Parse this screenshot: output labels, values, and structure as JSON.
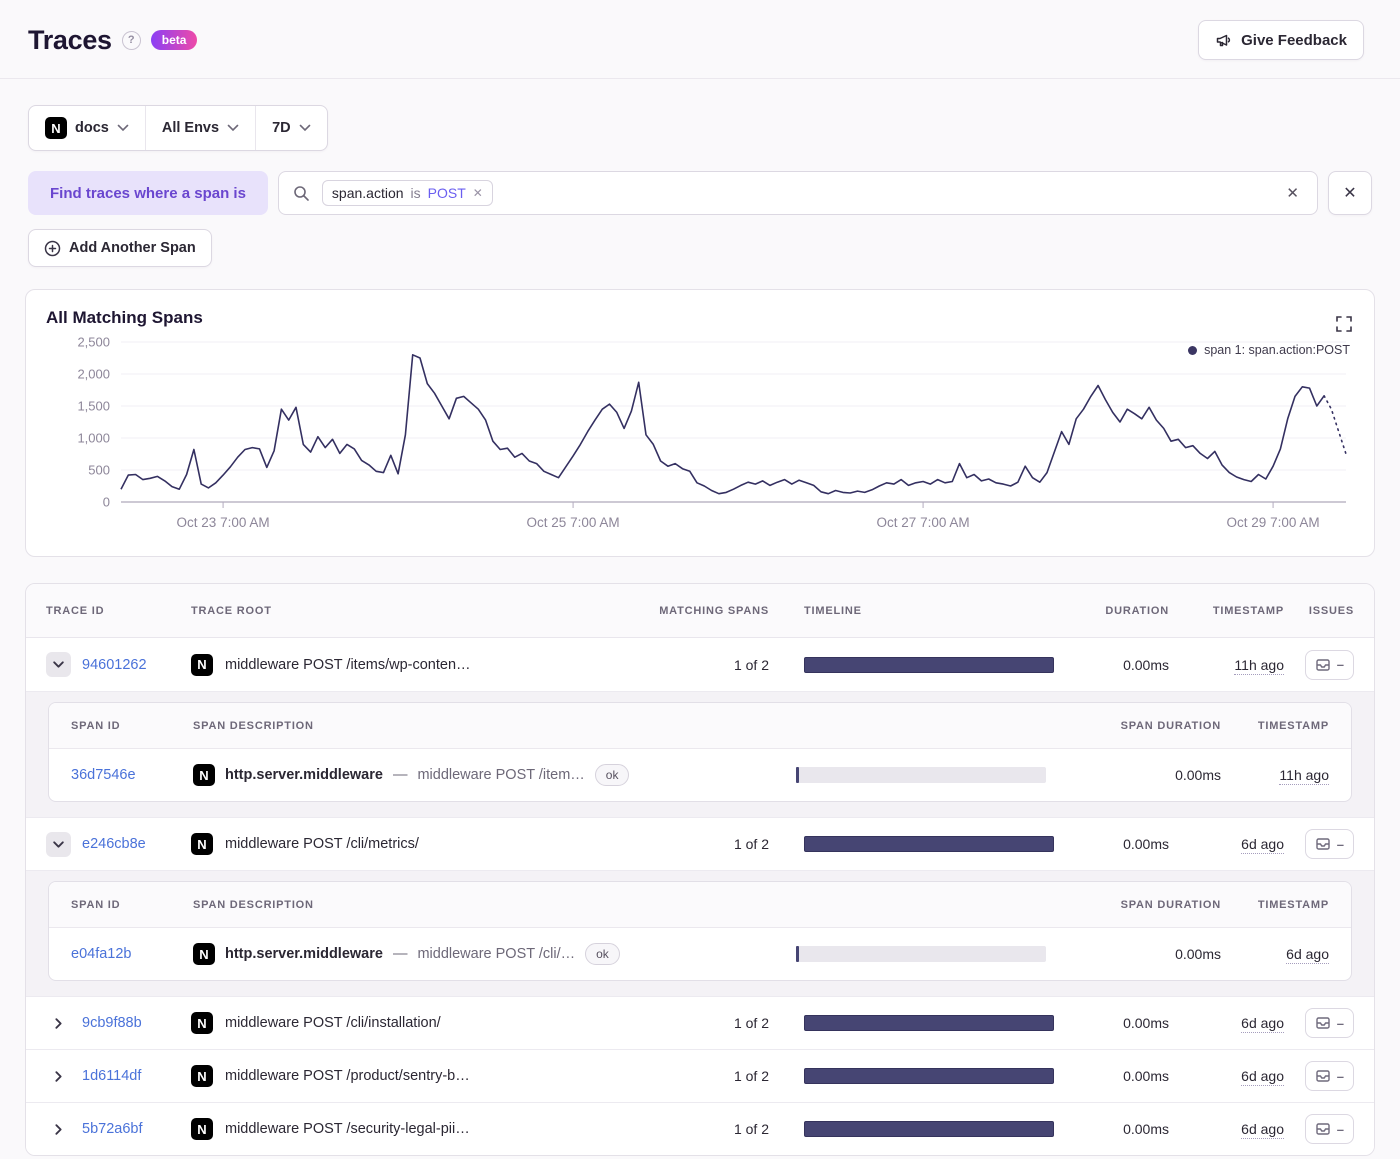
{
  "header": {
    "title": "Traces",
    "beta_badge": "beta",
    "feedback_button": "Give Feedback"
  },
  "filters": {
    "project": "docs",
    "environment": "All Envs",
    "date_range": "7D"
  },
  "search": {
    "prefix_label": "Find traces where a span is",
    "token": {
      "key": "span.action",
      "op": "is",
      "value": "POST"
    },
    "add_span_button": "Add Another Span"
  },
  "chart": {
    "title": "All Matching Spans",
    "legend_label": "span 1: span.action:POST",
    "line_color": "#343061"
  },
  "chart_data": {
    "type": "line",
    "title": "All Matching Spans",
    "legend": [
      "span 1: span.action:POST"
    ],
    "legend_position": "top-right",
    "grid": true,
    "ylim": [
      0,
      2500
    ],
    "y_ticks": [
      0,
      500,
      1000,
      1500,
      2000,
      2500
    ],
    "x_range_hours": [
      0,
      168
    ],
    "x_tick_positions_hours": [
      14,
      62,
      110,
      158
    ],
    "x_tick_labels": [
      "Oct 23 7:00 AM",
      "Oct 25 7:00 AM",
      "Oct 27 7:00 AM",
      "Oct 29 7:00 AM"
    ],
    "dashed_tail_points": 3,
    "series": [
      {
        "name": "span 1: span.action:POST",
        "values": [
          200,
          420,
          430,
          350,
          370,
          400,
          330,
          240,
          200,
          430,
          820,
          280,
          220,
          300,
          420,
          550,
          700,
          820,
          850,
          830,
          540,
          800,
          1450,
          1280,
          1480,
          900,
          780,
          1020,
          850,
          980,
          760,
          900,
          830,
          650,
          580,
          480,
          460,
          730,
          440,
          1050,
          2300,
          2250,
          1850,
          1700,
          1500,
          1300,
          1620,
          1650,
          1550,
          1450,
          1280,
          950,
          820,
          840,
          700,
          760,
          640,
          600,
          480,
          430,
          380,
          550,
          720,
          900,
          1100,
          1280,
          1450,
          1530,
          1400,
          1150,
          1420,
          1870,
          1050,
          900,
          640,
          560,
          600,
          520,
          480,
          300,
          250,
          180,
          130,
          150,
          200,
          260,
          310,
          280,
          330,
          260,
          310,
          350,
          280,
          340,
          300,
          260,
          160,
          130,
          180,
          150,
          140,
          170,
          150,
          190,
          250,
          300,
          280,
          350,
          260,
          300,
          320,
          280,
          350,
          300,
          320,
          600,
          380,
          430,
          330,
          360,
          300,
          280,
          250,
          310,
          560,
          380,
          310,
          460,
          780,
          1100,
          900,
          1300,
          1450,
          1650,
          1820,
          1600,
          1400,
          1250,
          1450,
          1380,
          1300,
          1480,
          1280,
          1150,
          950,
          980,
          850,
          880,
          760,
          680,
          790,
          580,
          460,
          390,
          350,
          320,
          430,
          360,
          560,
          830,
          1300,
          1650,
          1800,
          1780,
          1500,
          1660,
          1450,
          1100,
          750
        ]
      }
    ]
  },
  "table": {
    "headers": {
      "trace_id": "TRACE ID",
      "trace_root": "TRACE ROOT",
      "matching_spans": "MATCHING SPANS",
      "timeline": "TIMELINE",
      "duration": "DURATION",
      "timestamp": "TIMESTAMP",
      "issues": "ISSUES"
    },
    "span_headers": {
      "span_id": "SPAN ID",
      "span_description": "SPAN DESCRIPTION",
      "span_duration": "SPAN DURATION",
      "timestamp": "TIMESTAMP"
    },
    "rows": [
      {
        "trace_id": "94601262",
        "expanded": true,
        "root": "middleware POST /items/wp-conten…",
        "matching_spans": "1 of 2",
        "duration": "0.00ms",
        "timestamp": "11h ago",
        "spans": [
          {
            "span_id": "36d7546e",
            "op": "http.server.middleware",
            "description": "middleware POST /item…",
            "status": "ok",
            "duration": "0.00ms",
            "timestamp": "11h ago"
          }
        ]
      },
      {
        "trace_id": "e246cb8e",
        "expanded": true,
        "root": "middleware POST /cli/metrics/",
        "matching_spans": "1 of 2",
        "duration": "0.00ms",
        "timestamp": "6d ago",
        "spans": [
          {
            "span_id": "e04fa12b",
            "op": "http.server.middleware",
            "description": "middleware POST /cli/…",
            "status": "ok",
            "duration": "0.00ms",
            "timestamp": "6d ago"
          }
        ]
      },
      {
        "trace_id": "9cb9f88b",
        "expanded": false,
        "root": "middleware POST /cli/installation/",
        "matching_spans": "1 of 2",
        "duration": "0.00ms",
        "timestamp": "6d ago",
        "spans": []
      },
      {
        "trace_id": "1d6114df",
        "expanded": false,
        "root": "middleware POST /product/sentry-b…",
        "matching_spans": "1 of 2",
        "duration": "0.00ms",
        "timestamp": "6d ago",
        "spans": []
      },
      {
        "trace_id": "5b72a6bf",
        "expanded": false,
        "root": "middleware POST /security-legal-pii…",
        "matching_spans": "1 of 2",
        "duration": "0.00ms",
        "timestamp": "6d ago",
        "spans": []
      }
    ]
  },
  "colors": {
    "accent_purple": "#6a46cf",
    "token_value_purple": "#6a5ef0",
    "link_blue": "#4a72d9",
    "timeline_bar": "#464573",
    "chart_line": "#343061",
    "beta_gradient_start": "#8b3ff5",
    "beta_gradient_end": "#ee4aa8"
  }
}
